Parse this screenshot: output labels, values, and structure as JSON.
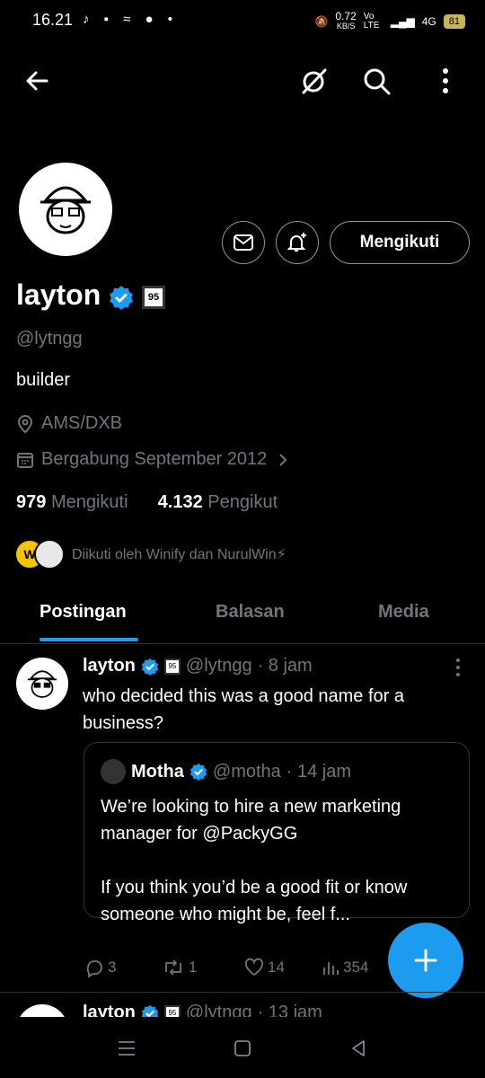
{
  "status_bar": {
    "time": "16.21",
    "left_icons": "♪ ▪ ≈ ● •",
    "speed": "0.72",
    "speed_unit": "KB/S",
    "network": "Vo LTE",
    "signal": "4G",
    "battery": "81"
  },
  "profile": {
    "name": "layton",
    "handle": "@lytngg",
    "bio": "builder",
    "location": "AMS/DXB",
    "joined": "Bergabung September 2012",
    "following_count": "979",
    "following_label": "Mengikuti",
    "followers_count": "4.132",
    "followers_label": "Pengikut",
    "followed_by": "Diikuti oleh Winify dan NurulWin⚡",
    "badge": "95",
    "follow_button": "Mengikuti",
    "verified_color": "#1d9bf0"
  },
  "tabs": [
    {
      "label": "Postingan",
      "active": true
    },
    {
      "label": "Balasan",
      "active": false
    },
    {
      "label": "Media",
      "active": false
    }
  ],
  "tweet": {
    "name": "layton",
    "handle": "@lytngg",
    "time": "· 8 jam",
    "text": "who decided this was a good name for a business?",
    "quote": {
      "name": "Motha",
      "handle": "@motha",
      "time": "· 14 jam",
      "text": "We’re looking to hire a new marketing manager for @PackyGG\n\nIf you think you’d be a good fit or know someone who might be, feel f..."
    },
    "replies": "3",
    "retweets": "1",
    "likes": "14",
    "views": "354"
  },
  "tweet2": {
    "name": "layton",
    "handle": "@lytngg",
    "time": "· 13 jam"
  },
  "accent_color": "#1d9bf0"
}
